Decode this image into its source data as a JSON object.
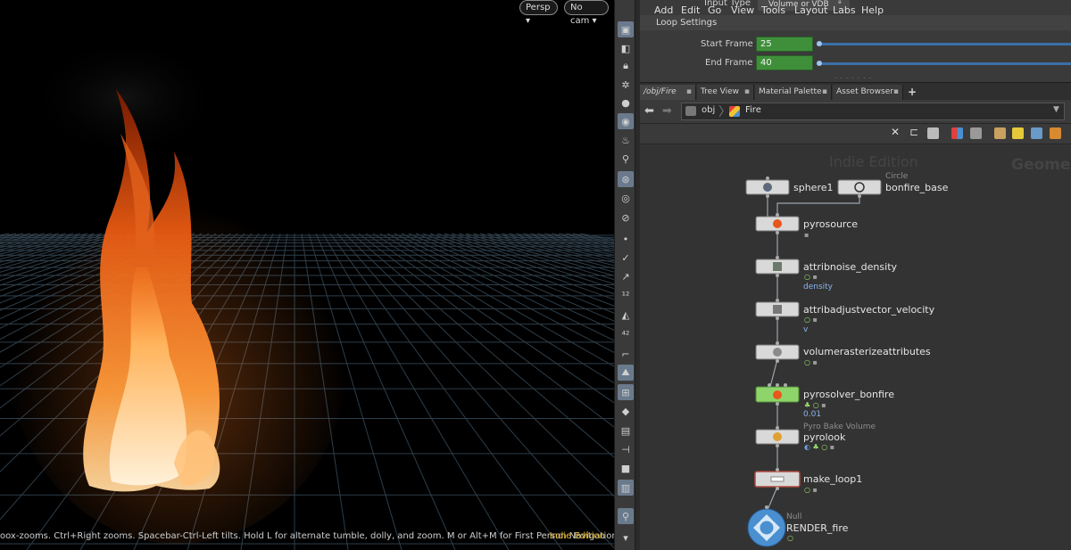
{
  "viewport": {
    "persp_label": "Persp ▾",
    "camera_label": "No cam ▾",
    "status": "oox-zooms. Ctrl+Right zooms. Spacebar-Ctrl-Left tilts. Hold L for alternate tumble, dolly, and zoom.    M or Alt+M for First Person Navigation.",
    "edition": "Indie Edition"
  },
  "params": {
    "input_type_label": "Input Type",
    "input_type_value": "Volume or VDB",
    "loop_settings_title": "Loop Settings",
    "start_frame_label": "Start Frame",
    "start_frame_value": "25",
    "end_frame_label": "End Frame",
    "end_frame_value": "40"
  },
  "tabs": [
    {
      "label": "/obj/Fire"
    },
    {
      "label": "Tree View"
    },
    {
      "label": "Material Palette"
    },
    {
      "label": "Asset Browser"
    },
    {
      "label": "+"
    }
  ],
  "path": {
    "root": "obj",
    "current": "Fire"
  },
  "menu": [
    "Add",
    "Edit",
    "Go",
    "View",
    "Tools",
    "Layout",
    "Labs",
    "Help"
  ],
  "network": {
    "watermark": "Indie Edition",
    "context_watermark": "Geome",
    "nodes": [
      {
        "name": "sphere1",
        "comment": "",
        "sub": ""
      },
      {
        "name": "bonfire_base",
        "comment": "Circle",
        "sub": ""
      },
      {
        "name": "pyrosource",
        "comment": "",
        "sub": ""
      },
      {
        "name": "attribnoise_density",
        "comment": "",
        "sub": "density"
      },
      {
        "name": "attribadjustvector_velocity",
        "comment": "",
        "sub": "v"
      },
      {
        "name": "volumerasterizeattributes",
        "comment": "",
        "sub": ""
      },
      {
        "name": "pyrosolver_bonfire",
        "comment": "",
        "sub": "0.01"
      },
      {
        "name": "pyrolook",
        "comment": "Pyro Bake Volume",
        "sub": ""
      },
      {
        "name": "make_loop1",
        "comment": "",
        "sub": ""
      },
      {
        "name": "RENDER_fire",
        "comment": "Null",
        "sub": ""
      }
    ]
  },
  "colors": {
    "param_green": "#3f8f3a",
    "slider_blue": "#3b6fa8",
    "solver_node_green": "#8fd46a",
    "edition_yellow": "#e5b82f",
    "null_node_blue": "#4a8fd0"
  }
}
